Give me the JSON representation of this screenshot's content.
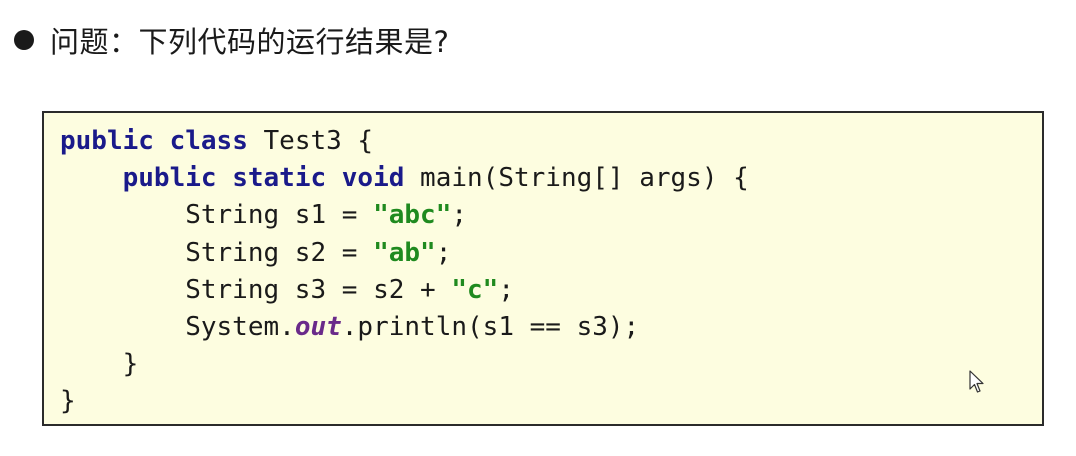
{
  "question": {
    "text": "问题：下列代码的运行结果是?"
  },
  "code": {
    "lines": [
      [
        {
          "t": "public",
          "c": "kw"
        },
        {
          "t": " "
        },
        {
          "t": "class",
          "c": "kw"
        },
        {
          "t": " Test3 {"
        }
      ],
      [
        {
          "t": "    "
        },
        {
          "t": "public",
          "c": "kw"
        },
        {
          "t": " "
        },
        {
          "t": "static",
          "c": "kw"
        },
        {
          "t": " "
        },
        {
          "t": "void",
          "c": "kw"
        },
        {
          "t": " main(String[] args) {"
        }
      ],
      [
        {
          "t": "        String s1 = "
        },
        {
          "t": "\"abc\"",
          "c": "str"
        },
        {
          "t": ";"
        }
      ],
      [
        {
          "t": "        String s2 = "
        },
        {
          "t": "\"ab\"",
          "c": "str"
        },
        {
          "t": ";"
        }
      ],
      [
        {
          "t": "        String s3 = s2 + "
        },
        {
          "t": "\"c\"",
          "c": "str"
        },
        {
          "t": ";"
        }
      ],
      [
        {
          "t": "        System."
        },
        {
          "t": "out",
          "c": "fld"
        },
        {
          "t": ".println(s1 == s3);"
        }
      ],
      [
        {
          "t": "    }"
        }
      ],
      [
        {
          "t": "}"
        }
      ]
    ]
  },
  "colors": {
    "keyword": "#1a1a8a",
    "string": "#1f8a1f",
    "field": "#6a2a8a",
    "code_background": "#fdfde0"
  },
  "icons": {
    "bullet": "bullet-dot-icon",
    "cursor": "mouse-pointer-icon"
  }
}
